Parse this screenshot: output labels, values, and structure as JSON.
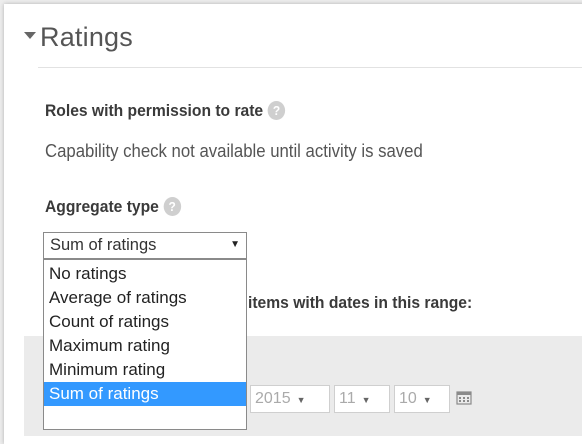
{
  "section": {
    "title": "Ratings"
  },
  "roles": {
    "label": "Roles with permission to rate",
    "help": "?",
    "info": "Capability check not available until activity is saved"
  },
  "aggregate": {
    "label": "Aggregate type",
    "help": "?",
    "selected": "Sum of ratings",
    "options": [
      "No ratings",
      "Average of ratings",
      "Count of ratings",
      "Maximum rating",
      "Minimum rating",
      "Sum of ratings"
    ]
  },
  "range": {
    "label_fragment": "items with dates in this range:",
    "year": "2015",
    "month": "11",
    "day": "10"
  },
  "icons": {
    "collapse": "caret-down-icon",
    "dropdown": "triangle-down-icon",
    "calendar": "calendar-icon"
  },
  "colors": {
    "highlight": "#3399ff",
    "help_badge": "#cfcfcf"
  }
}
